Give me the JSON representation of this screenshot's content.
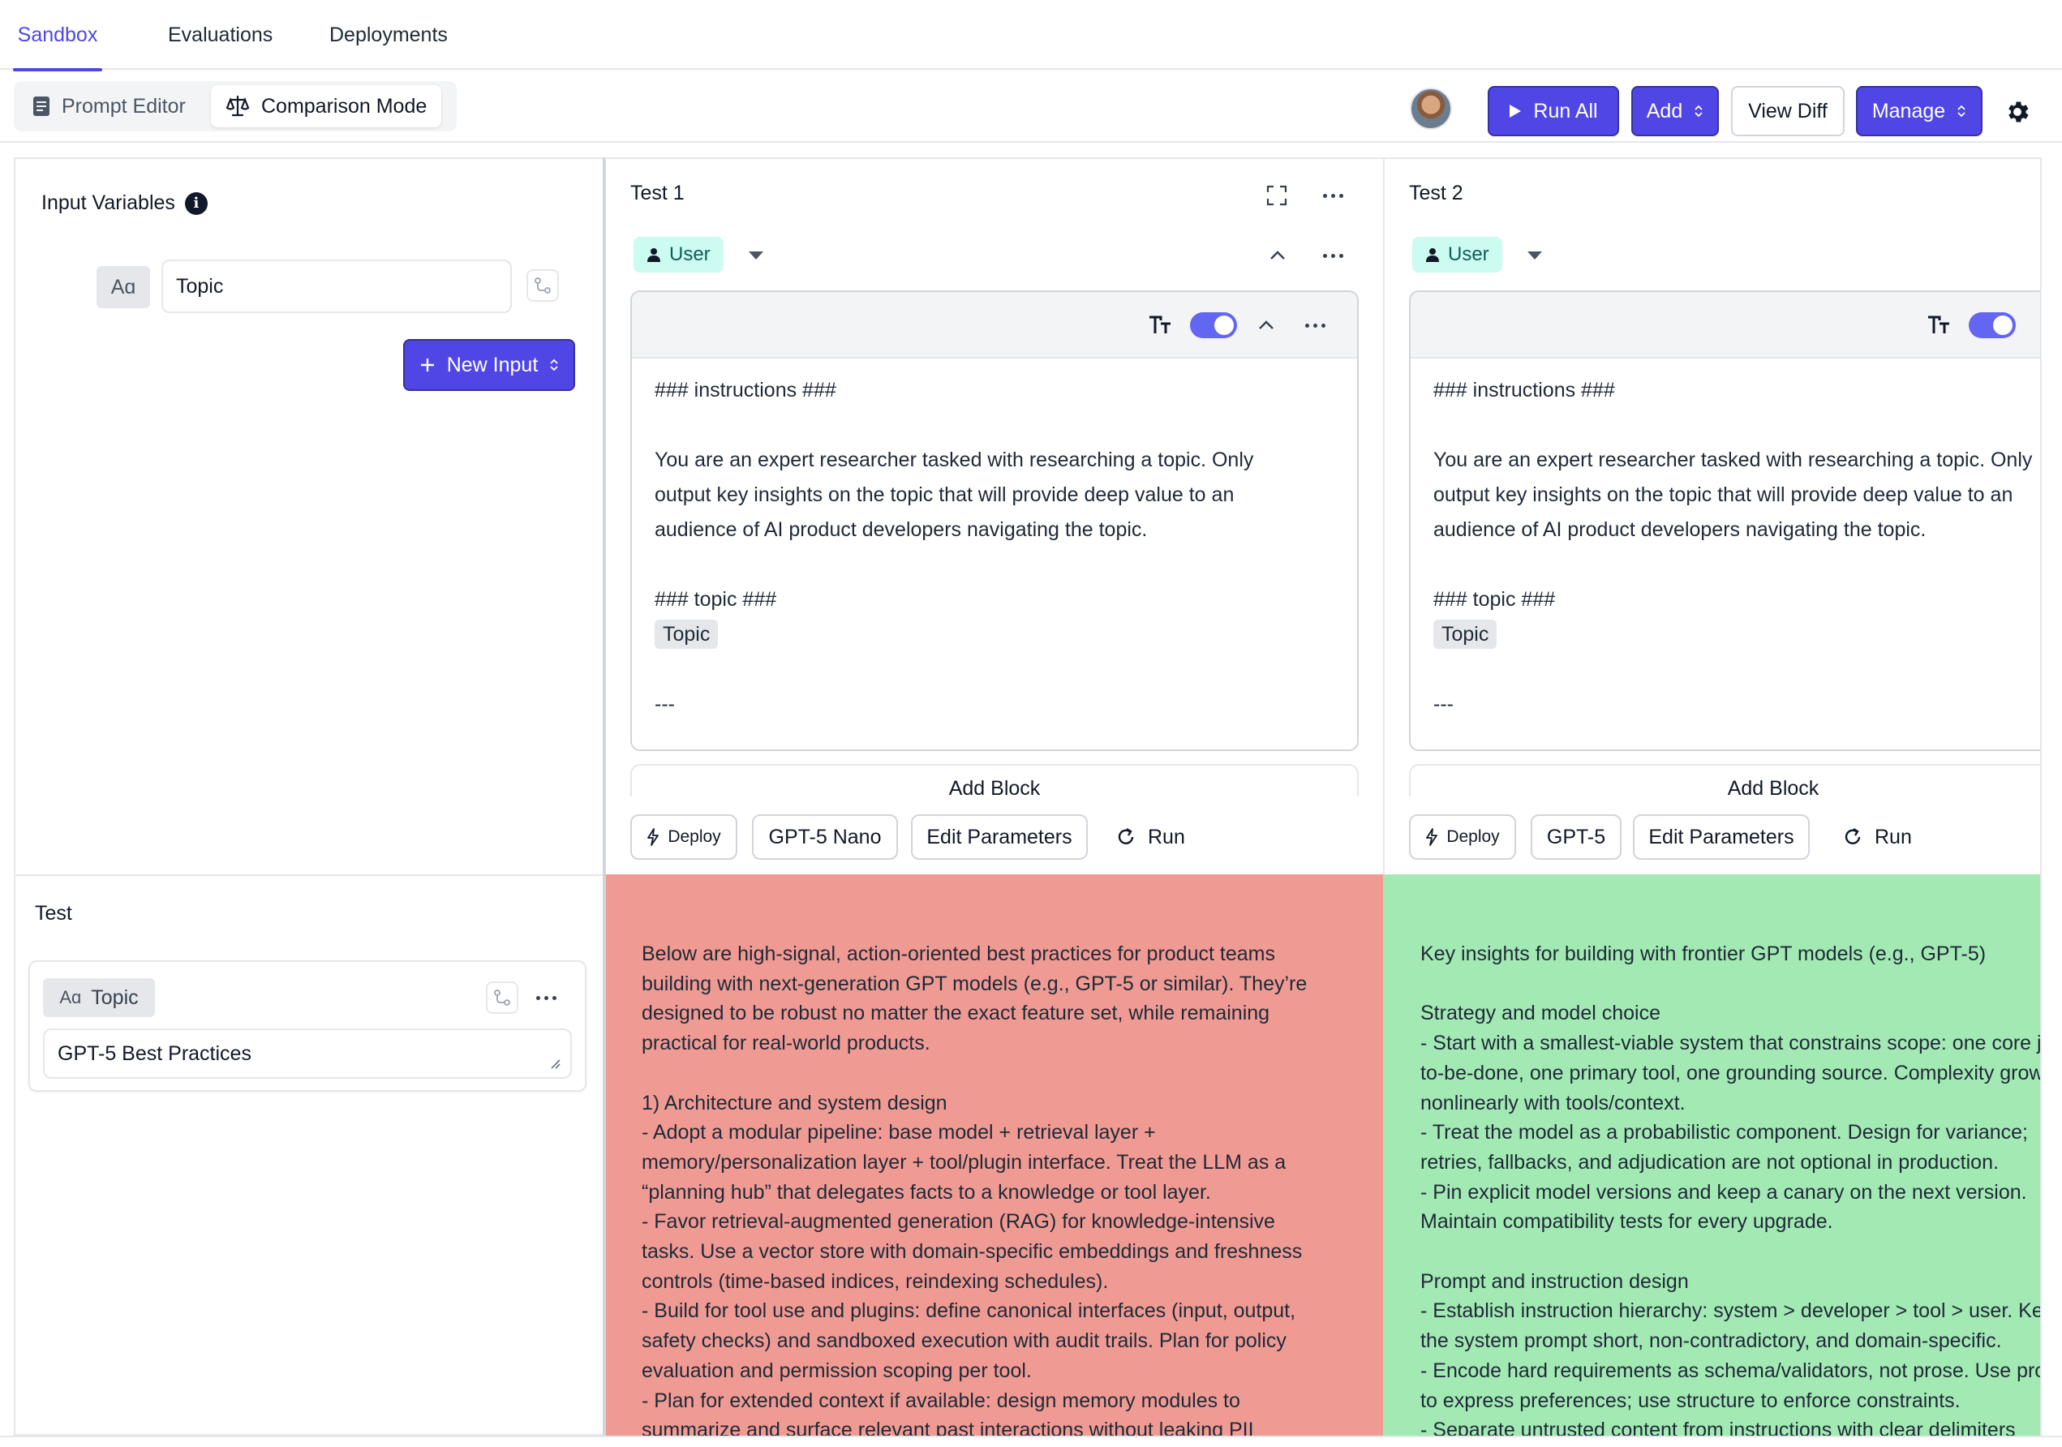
{
  "top_tabs": [
    {
      "label": "Sandbox",
      "active": true
    },
    {
      "label": "Evaluations",
      "active": false
    },
    {
      "label": "Deployments",
      "active": false
    }
  ],
  "toolbar": {
    "mode_prompt_editor": "Prompt Editor",
    "mode_comparison": "Comparison Mode",
    "run_all": "Run All",
    "add": "Add",
    "view_diff": "View Diff",
    "manage": "Manage"
  },
  "input_variables": {
    "title": "Input Variables",
    "type_badge": "Aɑ",
    "variable_name": "Topic",
    "new_input": "New Input"
  },
  "test_panel": {
    "title": "Test",
    "type_badge": "Aɑ",
    "variable_name": "Topic",
    "value": "GPT-5 Best Practices"
  },
  "tests": [
    {
      "title": "Test 1",
      "role": "User",
      "prompt_lines": [
        "### instructions ###",
        "",
        "You are an expert researcher tasked with researching a topic. Only",
        "output key insights on the topic that will provide deep value to an",
        "audience of AI product developers navigating the topic.",
        "",
        "### topic ###"
      ],
      "prompt_variable": "Topic",
      "prompt_tail": "---",
      "add_block": "Add Block",
      "deploy": "Deploy",
      "model": "GPT-5 Nano",
      "edit_parameters": "Edit Parameters",
      "run": "Run",
      "output_color": "#ef9b93",
      "output": "Below are high-signal, action-oriented best practices for product teams\nbuilding with next-generation GPT models (e.g., GPT-5 or similar). They’re\ndesigned to be robust no matter the exact feature set, while remaining\npractical for real-world products.\n\n1) Architecture and system design\n- Adopt a modular pipeline: base model + retrieval layer +\nmemory/personalization layer + tool/plugin interface. Treat the LLM as a\n“planning hub” that delegates facts to a knowledge or tool layer.\n- Favor retrieval-augmented generation (RAG) for knowledge-intensive\ntasks. Use a vector store with domain-specific embeddings and freshness\ncontrols (time-based indices, reindexing schedules).\n- Build for tool use and plugins: define canonical interfaces (input, output,\nsafety checks) and sandboxed execution with audit trails. Plan for policy\nevaluation and permission scoping per tool.\n- Plan for extended context if available: design memory modules to\nsummarize and surface relevant past interactions without leaking PII"
    },
    {
      "title": "Test 2",
      "role": "User",
      "prompt_lines": [
        "### instructions ###",
        "",
        "You are an expert researcher tasked with researching a topic. Only",
        "output key insights on the topic that will provide deep value to an",
        "audience of AI product developers navigating the topic.",
        "",
        "### topic ###"
      ],
      "prompt_variable": "Topic",
      "prompt_tail": "---",
      "add_block": "Add Block",
      "deploy": "Deploy",
      "model": "GPT-5",
      "edit_parameters": "Edit Parameters",
      "run": "Run",
      "output_color": "#a3e9b4",
      "output": "Key insights for building with frontier GPT models (e.g., GPT-5)\n\nStrategy and model choice\n- Start with a smallest-viable system that constrains scope: one core job-\nto-be-done, one primary tool, one grounding source. Complexity grows\nnonlinearly with tools/context.\n- Treat the model as a probabilistic component. Design for variance;\nretries, fallbacks, and adjudication are not optional in production.\n- Pin explicit model versions and keep a canary on the next version.\nMaintain compatibility tests for every upgrade.\n\nPrompt and instruction design\n- Establish instruction hierarchy: system > developer > tool > user. Keep\nthe system prompt short, non-contradictory, and domain-specific.\n- Encode hard requirements as schema/validators, not prose. Use prose\nto express preferences; use structure to enforce constraints.\n- Separate untrusted content from instructions with clear delimiters"
    }
  ]
}
